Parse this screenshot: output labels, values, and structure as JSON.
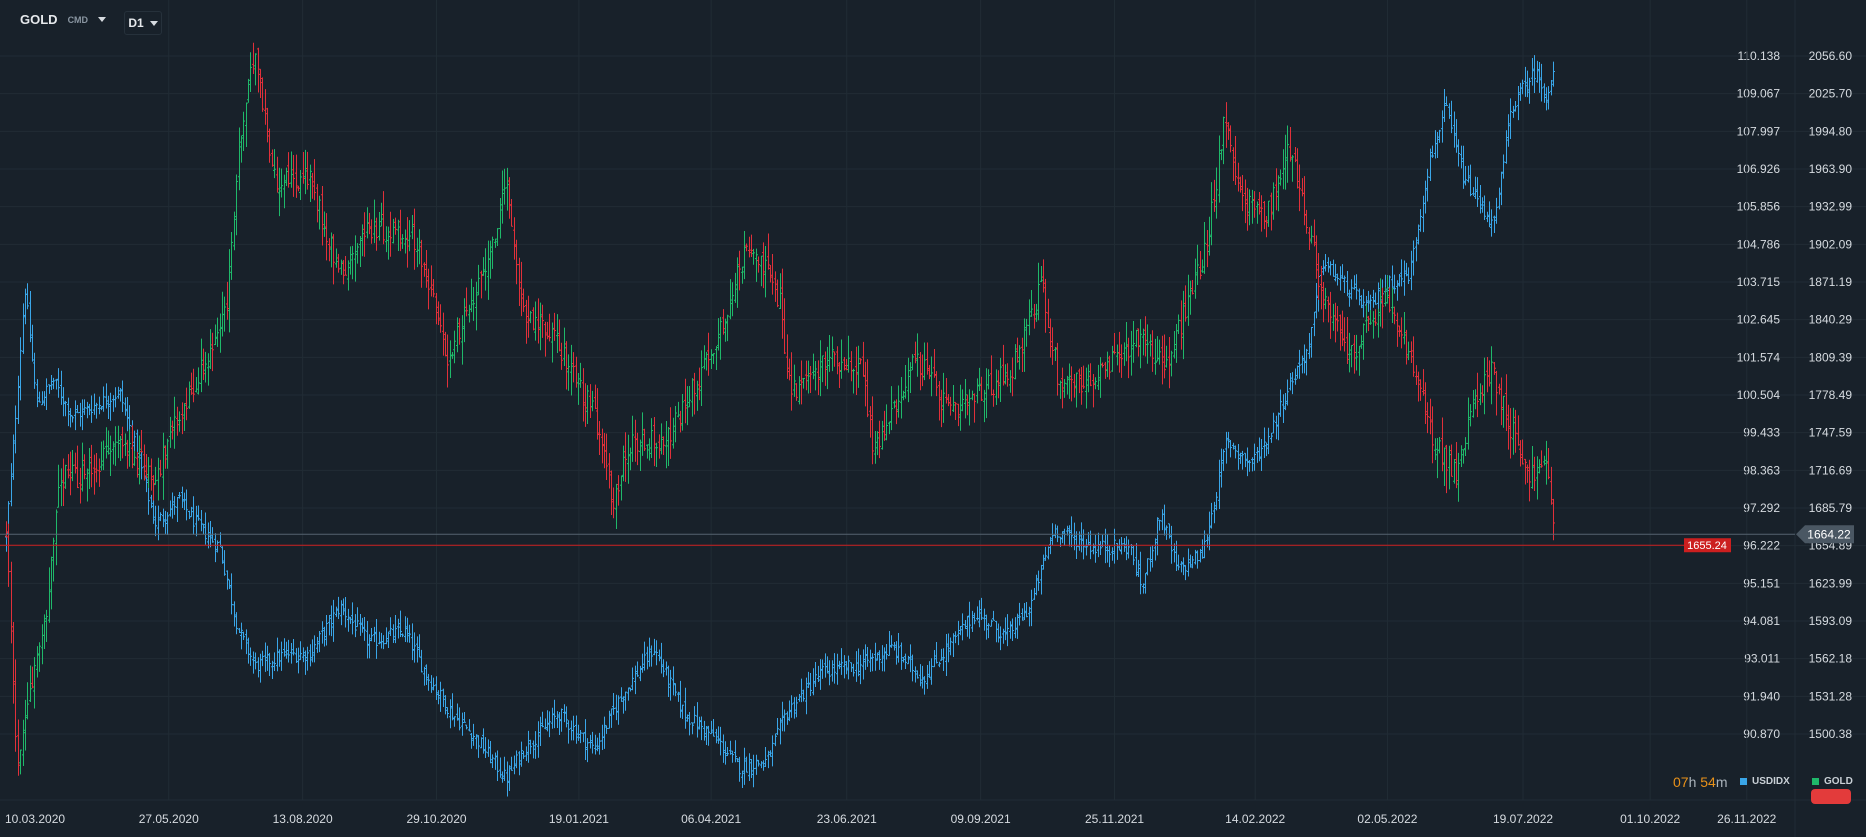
{
  "header": {
    "symbol": "GOLD",
    "type": "CMD",
    "timeframe": "D1"
  },
  "timer": {
    "hours": "07",
    "h": "h",
    "minutes": "54",
    "m": "m"
  },
  "legend": [
    {
      "name": "USDIDX",
      "color": "#3aa6e8"
    },
    {
      "name": "GOLD",
      "color": "#1fb86a"
    }
  ],
  "colors": {
    "bg": "#18212a",
    "grid": "#212c35",
    "up": "#1fb86a",
    "down": "#e0303a",
    "usd": "#3aa6e8",
    "current_line": "#cc1f1f",
    "last_badge": "#4a5763"
  },
  "chart_data": {
    "type": "ohlc",
    "x_unit": "days from first bar (10.03.2020)",
    "x_ticks": [
      {
        "label": "10.03.2020",
        "day": 0
      },
      {
        "label": "27.05.2020",
        "day": 96
      },
      {
        "label": "13.08.2020",
        "day": 175
      },
      {
        "label": "29.10.2020",
        "day": 254
      },
      {
        "label": "19.01.2021",
        "day": 338
      },
      {
        "label": "06.04.2021",
        "day": 416
      },
      {
        "label": "23.06.2021",
        "day": 496
      },
      {
        "label": "09.09.2021",
        "day": 575
      },
      {
        "label": "25.11.2021",
        "day": 654
      },
      {
        "label": "14.02.2022",
        "day": 737
      },
      {
        "label": "02.05.2022",
        "day": 815
      },
      {
        "label": "19.07.2022",
        "day": 895
      },
      {
        "label": "01.10.2022",
        "day": 970
      },
      {
        "label": "26.11.2022",
        "day": 1027
      }
    ],
    "x_range": [
      0,
      1027
    ],
    "gold_axis": {
      "range": [
        1500.38,
        2056.6
      ],
      "ticks": [
        "2056.60",
        "2025.70",
        "1994.80",
        "1963.90",
        "1932.99",
        "1902.09",
        "1871.19",
        "1840.29",
        "1809.39",
        "1778.49",
        "1747.59",
        "1716.69",
        "1685.79",
        "1654.89",
        "1623.99",
        "1593.09",
        "1562.18",
        "1531.28",
        "1500.38"
      ]
    },
    "usd_axis": {
      "range": [
        90.87,
        110.138
      ],
      "ticks": [
        "110.138",
        "109.067",
        "107.997",
        "106.926",
        "105.856",
        "104.786",
        "103.715",
        "102.645",
        "101.574",
        "100.504",
        "99.433",
        "98.363",
        "97.292",
        "96.222",
        "95.151",
        "94.081",
        "93.011",
        "91.940",
        "90.870"
      ]
    },
    "gold_last": "1664.22",
    "gold_current": "1655.24",
    "series": [
      {
        "name": "GOLD",
        "style": "ohlc-updown",
        "points": [
          [
            0,
            1664
          ],
          [
            7,
            1468
          ],
          [
            12,
            1517
          ],
          [
            25,
            1615
          ],
          [
            32,
            1712
          ],
          [
            46,
            1712
          ],
          [
            67,
            1741
          ],
          [
            88,
            1712
          ],
          [
            102,
            1761
          ],
          [
            119,
            1810
          ],
          [
            130,
            1849
          ],
          [
            137,
            1976
          ],
          [
            147,
            2063
          ],
          [
            158,
            1956
          ],
          [
            179,
            1956
          ],
          [
            197,
            1878
          ],
          [
            214,
            1917
          ],
          [
            242,
            1907
          ],
          [
            260,
            1810
          ],
          [
            277,
            1858
          ],
          [
            295,
            1946
          ],
          [
            305,
            1849
          ],
          [
            326,
            1820
          ],
          [
            347,
            1761
          ],
          [
            358,
            1693
          ],
          [
            369,
            1741
          ],
          [
            390,
            1741
          ],
          [
            418,
            1820
          ],
          [
            439,
            1907
          ],
          [
            456,
            1858
          ],
          [
            463,
            1780
          ],
          [
            488,
            1810
          ],
          [
            505,
            1800
          ],
          [
            512,
            1732
          ],
          [
            537,
            1810
          ],
          [
            558,
            1761
          ],
          [
            593,
            1800
          ],
          [
            611,
            1868
          ],
          [
            621,
            1790
          ],
          [
            642,
            1790
          ],
          [
            670,
            1829
          ],
          [
            684,
            1800
          ],
          [
            698,
            1858
          ],
          [
            709,
            1907
          ],
          [
            719,
            2005
          ],
          [
            730,
            1936
          ],
          [
            744,
            1927
          ],
          [
            758,
            1985
          ],
          [
            769,
            1907
          ],
          [
            779,
            1849
          ],
          [
            793,
            1810
          ],
          [
            814,
            1858
          ],
          [
            828,
            1810
          ],
          [
            842,
            1741
          ],
          [
            856,
            1712
          ],
          [
            867,
            1780
          ],
          [
            877,
            1799
          ],
          [
            888,
            1751
          ],
          [
            899,
            1712
          ],
          [
            909,
            1722
          ],
          [
            914,
            1658
          ]
        ]
      },
      {
        "name": "USDIDX",
        "style": "ohlc-blue",
        "points": [
          [
            0,
            96.51
          ],
          [
            4,
            98.88
          ],
          [
            11,
            103.61
          ],
          [
            18,
            100.23
          ],
          [
            28,
            100.91
          ],
          [
            39,
            99.89
          ],
          [
            53,
            100.23
          ],
          [
            67,
            100.57
          ],
          [
            77,
            98.88
          ],
          [
            88,
            96.85
          ],
          [
            102,
            97.53
          ],
          [
            112,
            96.85
          ],
          [
            126,
            96.18
          ],
          [
            137,
            93.81
          ],
          [
            147,
            92.8
          ],
          [
            165,
            93.14
          ],
          [
            179,
            93.14
          ],
          [
            197,
            94.49
          ],
          [
            214,
            93.47
          ],
          [
            235,
            93.81
          ],
          [
            249,
            92.46
          ],
          [
            263,
            91.45
          ],
          [
            277,
            90.77
          ],
          [
            295,
            89.59
          ],
          [
            305,
            90.43
          ],
          [
            326,
            91.45
          ],
          [
            347,
            90.43
          ],
          [
            361,
            91.79
          ],
          [
            382,
            93.31
          ],
          [
            400,
            91.45
          ],
          [
            418,
            90.77
          ],
          [
            432,
            89.93
          ],
          [
            449,
            90.1
          ],
          [
            460,
            91.45
          ],
          [
            481,
            92.63
          ],
          [
            502,
            92.8
          ],
          [
            523,
            93.31
          ],
          [
            541,
            92.46
          ],
          [
            558,
            93.47
          ],
          [
            572,
            94.32
          ],
          [
            590,
            93.64
          ],
          [
            604,
            94.49
          ],
          [
            618,
            96.69
          ],
          [
            642,
            96.18
          ],
          [
            663,
            96.18
          ],
          [
            670,
            95.0
          ],
          [
            681,
            97.19
          ],
          [
            691,
            95.5
          ],
          [
            706,
            96.01
          ],
          [
            713,
            97.53
          ],
          [
            720,
            99.22
          ],
          [
            734,
            98.54
          ],
          [
            744,
            99.22
          ],
          [
            758,
            100.91
          ],
          [
            769,
            101.92
          ],
          [
            776,
            104.29
          ],
          [
            790,
            103.61
          ],
          [
            804,
            102.94
          ],
          [
            814,
            103.61
          ],
          [
            828,
            103.95
          ],
          [
            839,
            106.99
          ],
          [
            849,
            108.69
          ],
          [
            860,
            106.66
          ],
          [
            878,
            105.3
          ],
          [
            888,
            108.69
          ],
          [
            902,
            109.7
          ],
          [
            909,
            109.02
          ],
          [
            914,
            109.7
          ]
        ]
      }
    ]
  }
}
